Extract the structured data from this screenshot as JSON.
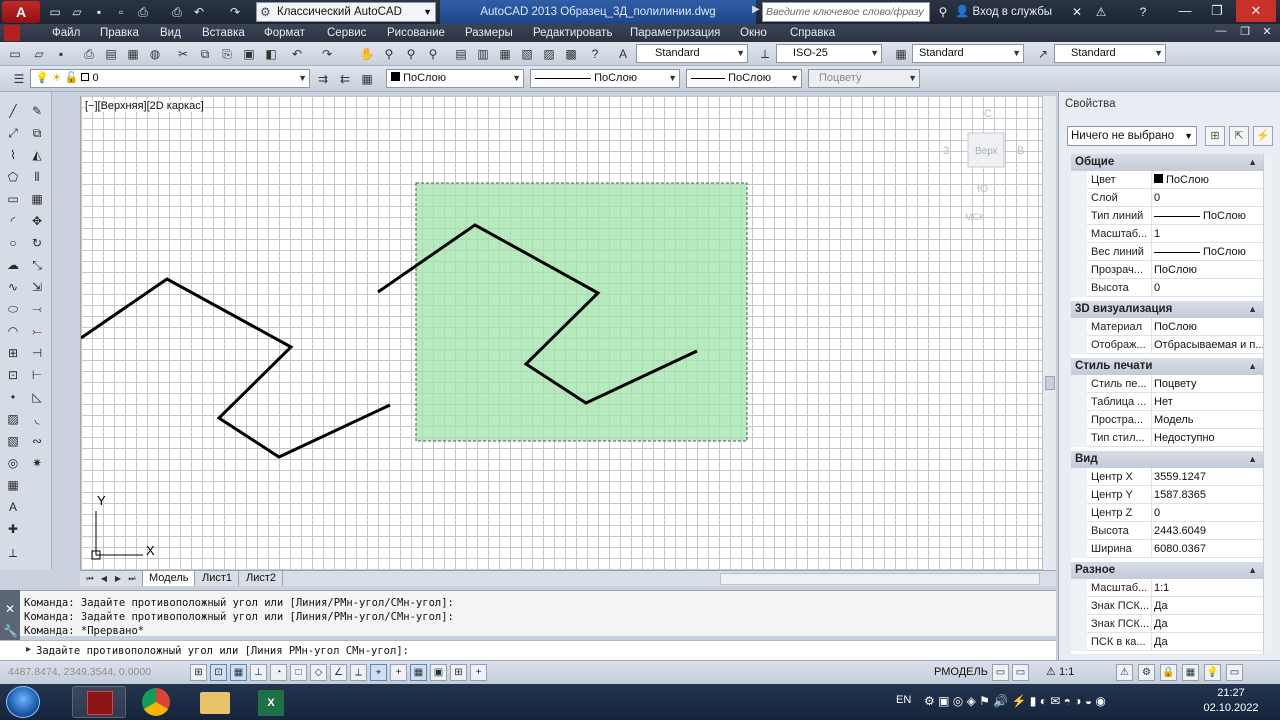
{
  "titlebar": {
    "workspace": "Классический AutoCAD",
    "document_title": "AutoCAD 2013   Образец_3Д_полилинии.dwg",
    "search_placeholder": "Введите ключевое слово/фразу",
    "signin": "Вход в службы"
  },
  "menubar": {
    "items": [
      "Файл",
      "Правка",
      "Вид",
      "Вставка",
      "Формат",
      "Сервис",
      "Рисование",
      "Размеры",
      "Редактировать",
      "Параметризация",
      "Окно",
      "Справка"
    ]
  },
  "toolbar1": {
    "text_style": "Standard",
    "dim_style": "ISO-25",
    "table_style": "Standard",
    "mleader_style": "Standard"
  },
  "toolbar2": {
    "layer": "0",
    "color": "ПоСлою",
    "linetype": "ПоСлою",
    "lineweight": "ПоСлою",
    "plotstyle": "Поцвету"
  },
  "canvas": {
    "view_label": "[−][Верхняя][2D каркас]",
    "viewcube": {
      "top": "Верх",
      "north": "С",
      "south": "Ю",
      "west": "З",
      "east": "В",
      "ucs": "МСК"
    },
    "ucs_x": "X",
    "ucs_y": "Y",
    "colors": {
      "grid": "#c8c8c8",
      "selection_fill": "#a8e6b0",
      "polyline": "#000000"
    }
  },
  "tabs": [
    "Модель",
    "Лист1",
    "Лист2"
  ],
  "properties": {
    "title": "Свойства",
    "selection": "Ничего не выбрано",
    "sections": [
      {
        "name": "Общие",
        "rows": [
          {
            "k": "Цвет",
            "v": "ПоСлою"
          },
          {
            "k": "Слой",
            "v": "0"
          },
          {
            "k": "Тип линий",
            "v": "ПоСлою"
          },
          {
            "k": "Масштаб...",
            "v": "1"
          },
          {
            "k": "Вес линий",
            "v": "ПоСлою"
          },
          {
            "k": "Прозрач...",
            "v": "ПоСлою"
          },
          {
            "k": "Высота",
            "v": "0"
          }
        ]
      },
      {
        "name": "3D визуализация",
        "rows": [
          {
            "k": "Материал",
            "v": "ПоСлою"
          },
          {
            "k": "Отображ...",
            "v": "Отбрасываемая и п..."
          }
        ]
      },
      {
        "name": "Стиль печати",
        "rows": [
          {
            "k": "Стиль пе...",
            "v": "Поцвету"
          },
          {
            "k": "Таблица ...",
            "v": "Нет"
          },
          {
            "k": "Простра...",
            "v": "Модель"
          },
          {
            "k": "Тип стил...",
            "v": "Недоступно"
          }
        ]
      },
      {
        "name": "Вид",
        "rows": [
          {
            "k": "Центр X",
            "v": "3559.1247"
          },
          {
            "k": "Центр Y",
            "v": "1587.8365"
          },
          {
            "k": "Центр Z",
            "v": "0"
          },
          {
            "k": "Высота",
            "v": "2443.6049"
          },
          {
            "k": "Ширина",
            "v": "6080.0367"
          }
        ]
      },
      {
        "name": "Разное",
        "rows": [
          {
            "k": "Масштаб...",
            "v": "1:1"
          },
          {
            "k": "Знак ПСК...",
            "v": "Да"
          },
          {
            "k": "Знак ПСК...",
            "v": "Да"
          },
          {
            "k": "ПСК в ка...",
            "v": "Да"
          }
        ]
      }
    ]
  },
  "command": {
    "history": [
      "Команда: Задайте противоположный угол или [Линия/РМн-угол/СМн-угол]:",
      "Команда: Задайте противоположный угол или [Линия/РМн-угол/СМн-угол]:",
      "Команда: *Прервано*"
    ],
    "prompt": "Задайте противоположный угол или [Линия РМн-угол СМн-угол]:"
  },
  "statusbar": {
    "coords": "4487.8474, 2349.3544, 0.0000",
    "space": "РМОДЕЛЬ",
    "scale": "1:1"
  },
  "taskbar": {
    "lang": "EN",
    "time": "21:27",
    "date": "02.10.2022"
  }
}
